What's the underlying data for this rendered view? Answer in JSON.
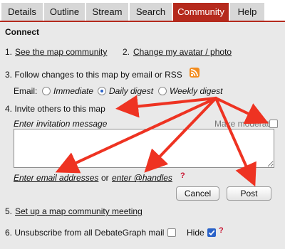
{
  "tabs": [
    {
      "label": "Details"
    },
    {
      "label": "Outline"
    },
    {
      "label": "Stream"
    },
    {
      "label": "Search"
    },
    {
      "label": "Community",
      "active": true
    },
    {
      "label": "Help"
    }
  ],
  "colors": {
    "accent": "#b52a1d",
    "panel_bg": "#e9e9e9",
    "arrow": "#ee3322",
    "rss": "#f28c1e"
  },
  "connect": {
    "heading": "Connect",
    "item1_num": "1.",
    "item1_link": "See the map community",
    "item2_num": "2.",
    "item2_link": "Change my avatar / photo",
    "item3_text": "3. Follow changes to this map by email or RSS",
    "rss_icon": "rss-icon",
    "email_label": "Email:",
    "email_options": [
      {
        "label": "Immediate",
        "selected": false
      },
      {
        "label": "Daily digest",
        "selected": true
      },
      {
        "label": "Weekly digest",
        "selected": false
      }
    ],
    "item4_text": "4. Invite others to this map",
    "invitation_label": "Enter invitation message",
    "make_moderator_label": "Make moderator",
    "make_moderator_checked": false,
    "invite_message_value": "",
    "email_addresses_link": "Enter email addresses",
    "or_text": "or",
    "handles_link": "enter @handles",
    "help_mark": "?",
    "cancel_label": "Cancel",
    "post_label": "Post",
    "item5_num": "5.",
    "item5_link": "Set up a map community meeting",
    "item6_text": "6. Unsubscribe from all DebateGraph mail",
    "unsubscribe_checked": false,
    "hide_label": "Hide",
    "hide_checked": true,
    "help_mark2": "?"
  }
}
